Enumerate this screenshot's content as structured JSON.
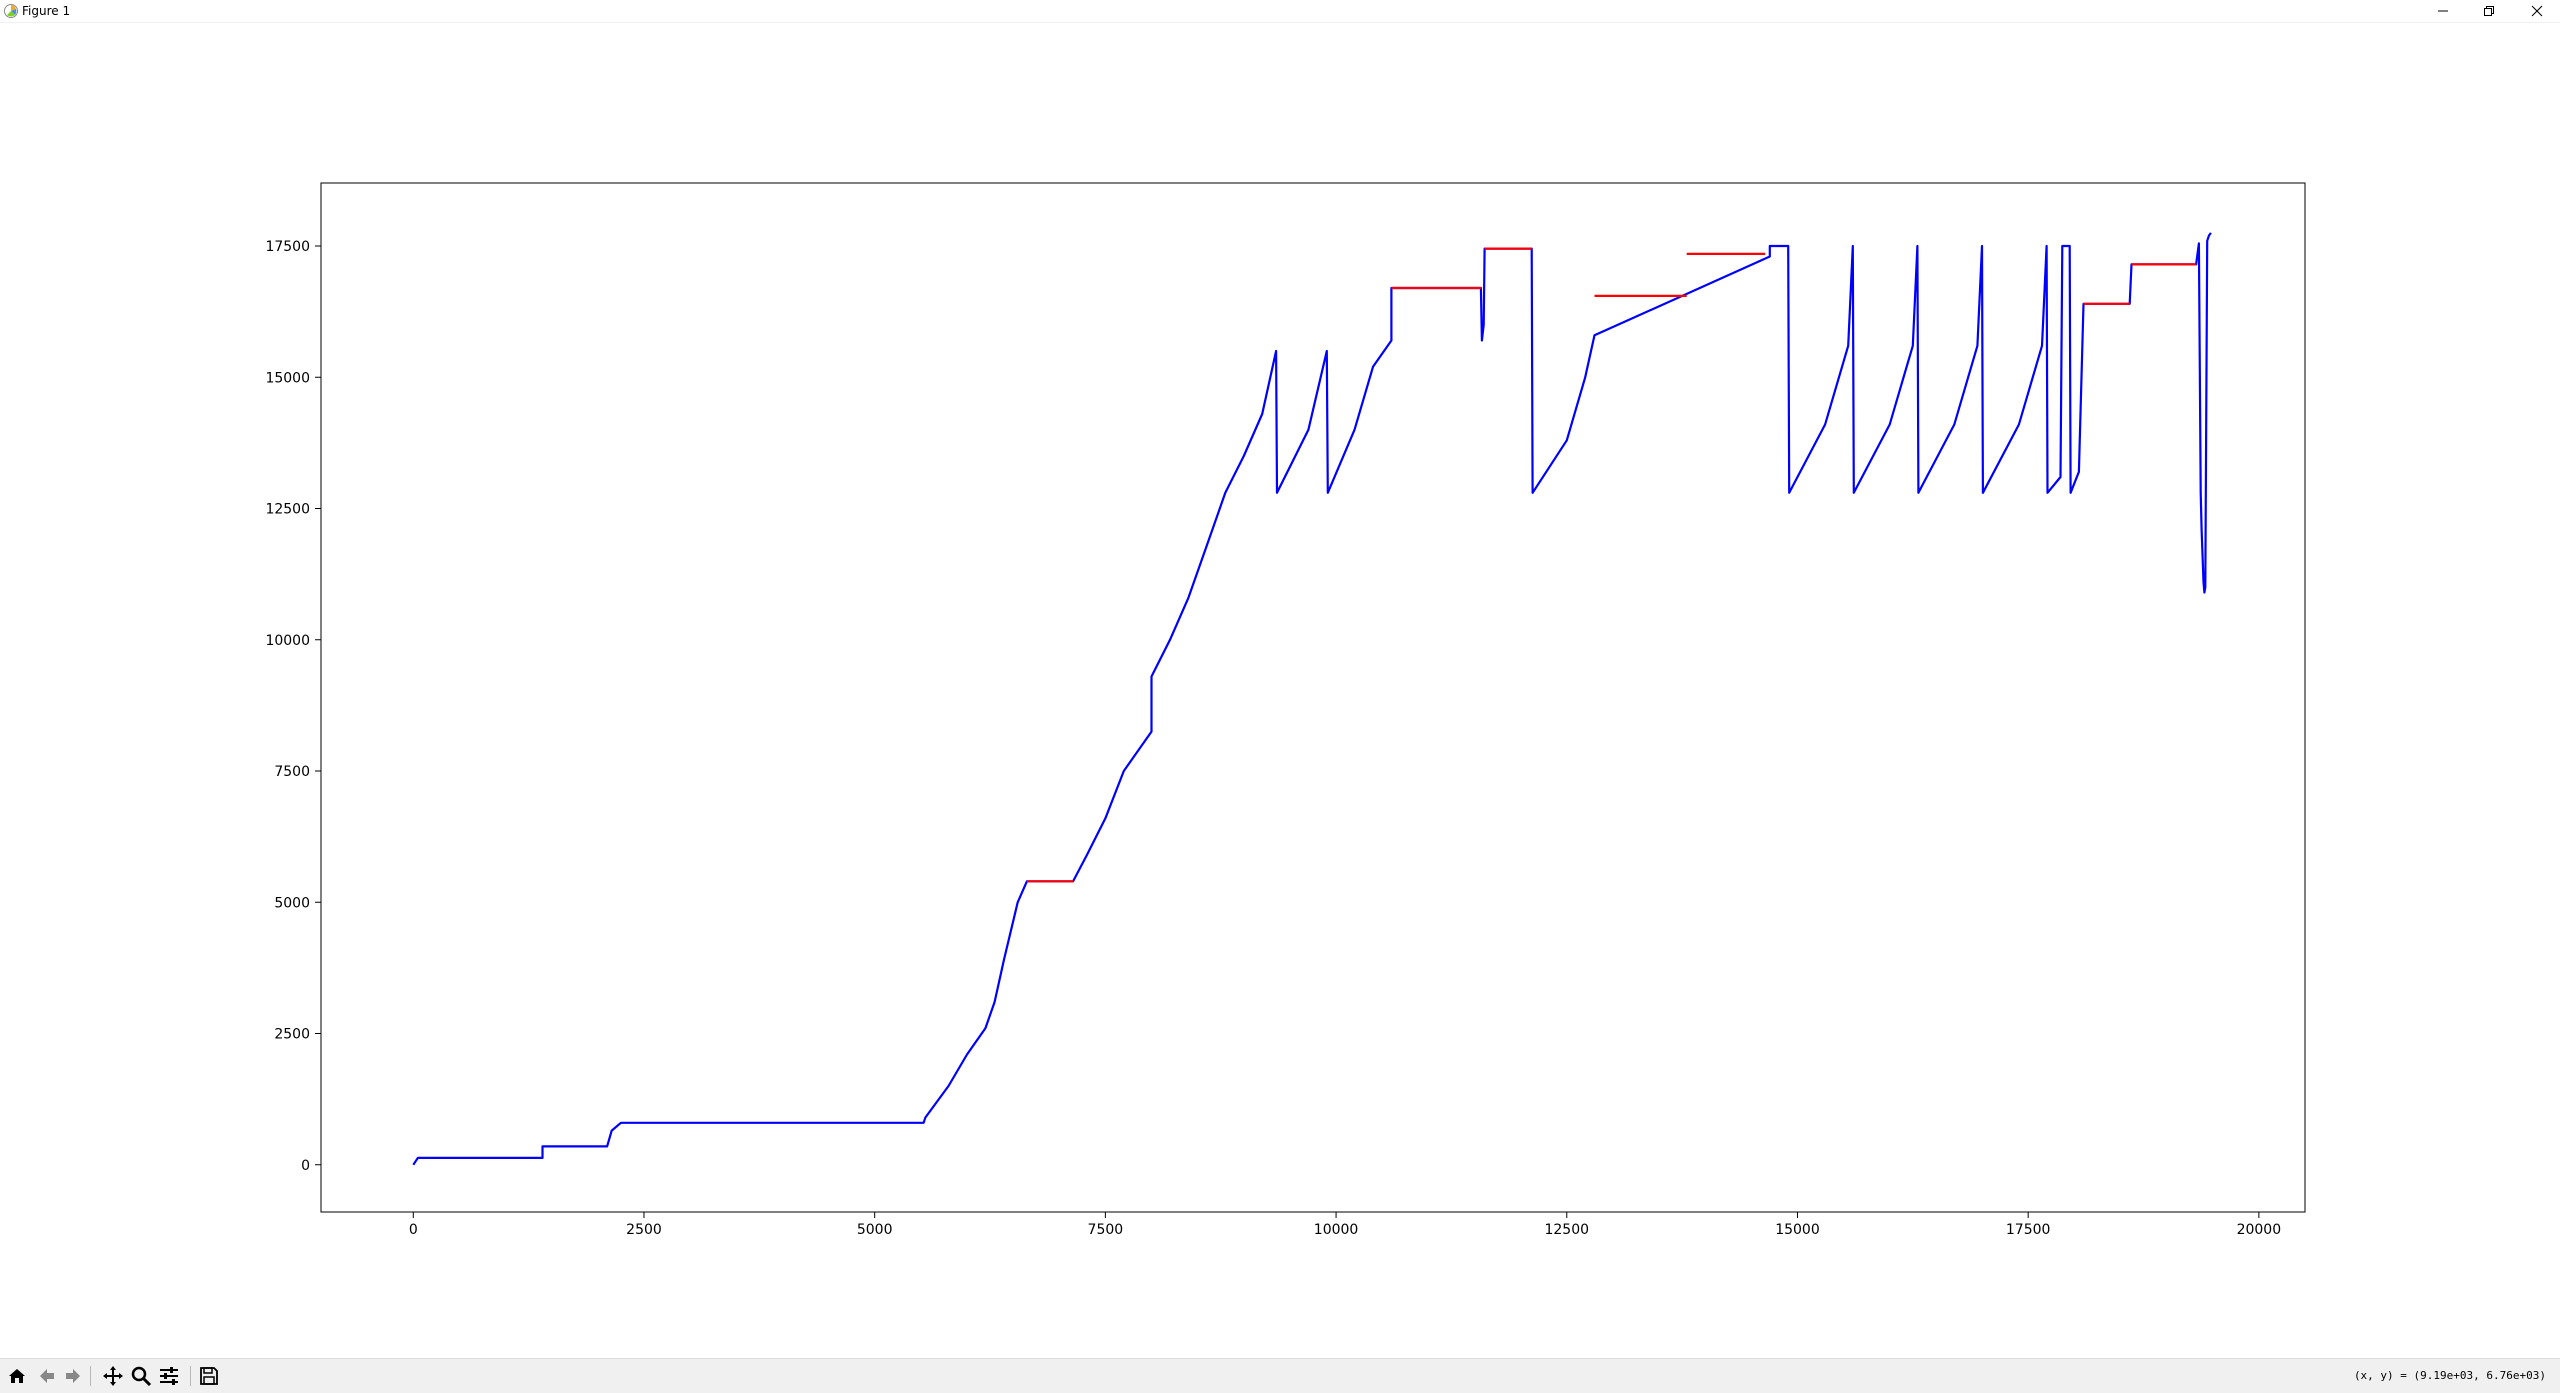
{
  "window": {
    "title": "Figure 1"
  },
  "toolbar": {
    "buttons": [
      {
        "name": "home",
        "icon": "home-icon"
      },
      {
        "name": "back",
        "icon": "back-arrow-icon"
      },
      {
        "name": "forward",
        "icon": "forward-arrow-icon"
      },
      {
        "name": "pan",
        "icon": "pan-icon"
      },
      {
        "name": "zoom",
        "icon": "zoom-icon"
      },
      {
        "name": "configure",
        "icon": "sliders-icon"
      },
      {
        "name": "save",
        "icon": "save-icon"
      }
    ],
    "coord_readout": "(x, y) = (9.19e+03, 6.76e+03)"
  },
  "chart_data": {
    "type": "line",
    "title": "",
    "xlabel": "",
    "ylabel": "",
    "xlim": [
      -1000,
      20500
    ],
    "ylim": [
      -900,
      18700
    ],
    "xticks": [
      0,
      2500,
      5000,
      7500,
      10000,
      12500,
      15000,
      17500,
      20000
    ],
    "xtick_labels": [
      "0",
      "2500",
      "5000",
      "7500",
      "10000",
      "12500",
      "15000",
      "17500",
      "20000"
    ],
    "yticks": [
      0,
      2500,
      5000,
      7500,
      10000,
      12500,
      15000,
      17500
    ],
    "ytick_labels": [
      "0",
      "2500",
      "5000",
      "7500",
      "10000",
      "12500",
      "15000",
      "17500"
    ],
    "grid": false,
    "colors": {
      "primary": "#0000ff",
      "secondary": "#ff0000"
    },
    "series": [
      {
        "color": "#0000ff",
        "x": [
          0,
          50,
          1400,
          1400,
          1450,
          2100,
          2150,
          2250,
          2250,
          5530,
          5550,
          5800,
          6000,
          6200,
          6300,
          6400,
          6550,
          6650,
          7150,
          7300,
          7500,
          7700,
          8000,
          8000,
          8200,
          8400,
          8600,
          8800,
          9000,
          9200,
          9350,
          9360,
          9700,
          9900,
          9910,
          10200,
          10400,
          10600,
          10600,
          11570,
          11580,
          11600,
          11610,
          12120,
          12130,
          12500,
          12700,
          12800,
          14700,
          14700,
          14900,
          14910,
          15300,
          15550,
          15600,
          15610,
          16000,
          16250,
          16300,
          16310,
          16700,
          16950,
          17000,
          17010,
          17400,
          17650,
          17700,
          17710,
          17850,
          17870,
          17950,
          17960,
          18050,
          18100,
          18600,
          18620,
          19320,
          19350,
          19370,
          19380,
          19400,
          19410,
          19420,
          19440,
          19460,
          19480
        ],
        "y": [
          0,
          130,
          130,
          350,
          350,
          350,
          650,
          800,
          800,
          800,
          900,
          1500,
          2100,
          2600,
          3100,
          3900,
          5000,
          5400,
          5400,
          5900,
          6600,
          7500,
          8250,
          9300,
          10000,
          10800,
          11800,
          12800,
          13500,
          14300,
          15500,
          12800,
          14000,
          15500,
          12800,
          14000,
          15200,
          15700,
          16700,
          16700,
          15700,
          16000,
          17450,
          17450,
          12800,
          13800,
          15000,
          15800,
          17300,
          17500,
          17500,
          12800,
          14100,
          15600,
          17500,
          12800,
          14100,
          15600,
          17500,
          12800,
          14100,
          15600,
          17500,
          12800,
          14100,
          15600,
          17500,
          12800,
          13100,
          17500,
          17500,
          12800,
          13200,
          16400,
          16400,
          17150,
          17150,
          17550,
          12800,
          12100,
          11100,
          10900,
          11000,
          17600,
          17700,
          17750
        ]
      },
      {
        "color": "#ff0000",
        "x": [
          6650,
          7150,
          null,
          10600,
          11570,
          null,
          11610,
          12120,
          null,
          12800,
          13800,
          null,
          13800,
          14650,
          null,
          18100,
          18600,
          null,
          18620,
          19320
        ],
        "y": [
          5400,
          5400,
          null,
          16700,
          16700,
          null,
          17450,
          17450,
          null,
          16550,
          16550,
          null,
          17350,
          17350,
          null,
          16400,
          16400,
          null,
          17150,
          17150
        ]
      }
    ]
  }
}
